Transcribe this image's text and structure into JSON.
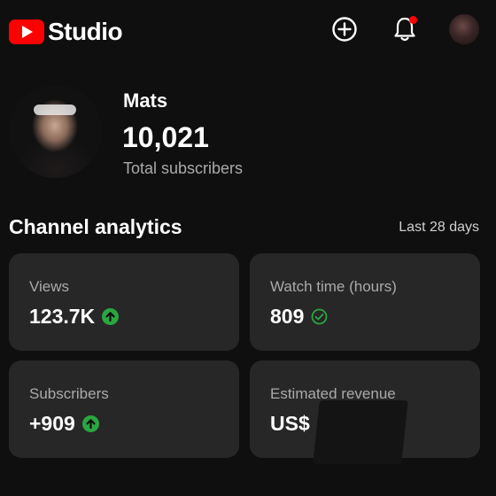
{
  "app": {
    "logo_text": "Studio"
  },
  "header": {
    "create_icon": "plus-circle-icon",
    "notifications_icon": "bell-icon",
    "notification_badge_color": "#ff0000"
  },
  "profile": {
    "channel_name": "Mats",
    "subscriber_count": "10,021",
    "subscriber_label": "Total subscribers"
  },
  "analytics": {
    "title": "Channel analytics",
    "period": "Last 28 days",
    "cards": [
      {
        "label": "Views",
        "value": "123.7K",
        "indicator": "up-arrow-icon"
      },
      {
        "label": "Watch time (hours)",
        "value": "809",
        "indicator": "check-circle-icon"
      },
      {
        "label": "Subscribers",
        "value": "+909",
        "indicator": "up-arrow-icon"
      },
      {
        "label": "Estimated revenue",
        "value": "US$",
        "indicator": "redacted"
      }
    ]
  },
  "colors": {
    "background": "#0f0f0f",
    "card": "#272727",
    "brand_red": "#ff0000",
    "positive_green": "#2ba640",
    "muted_text": "#aaaaaa"
  }
}
